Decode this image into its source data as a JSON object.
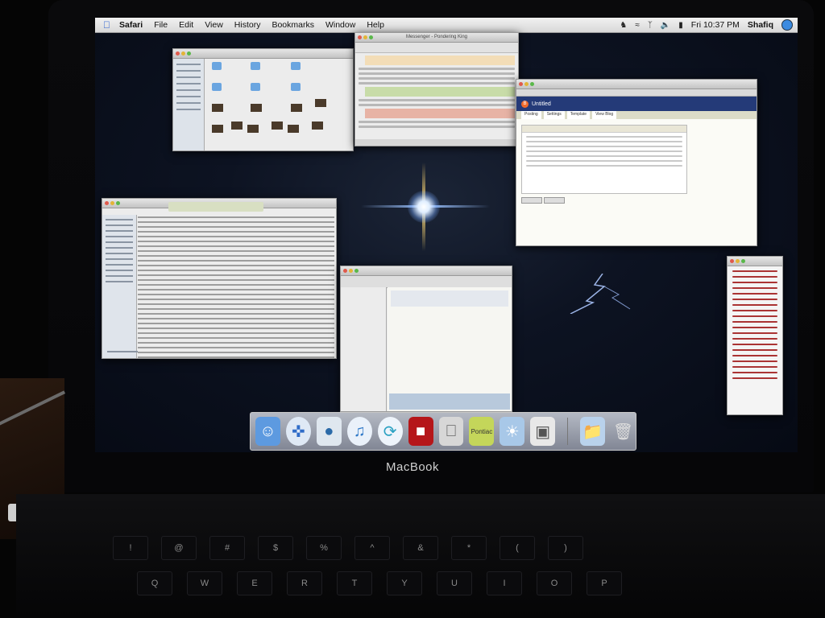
{
  "menubar": {
    "app": "Safari",
    "items": [
      "File",
      "Edit",
      "View",
      "History",
      "Bookmarks",
      "Window",
      "Help"
    ],
    "clock": "Fri 10:37 PM",
    "user": "Shafiq"
  },
  "windows": {
    "messenger_title": "Messenger - Pondering King",
    "blogger_title": "Untitled",
    "blogger_tabs": [
      "Posting",
      "Settings",
      "Template",
      "View Blog"
    ]
  },
  "dock": {
    "items": [
      "finder",
      "safari",
      "iphoto",
      "itunes",
      "messenger",
      "photo-booth",
      "system-prefs",
      "pontiac",
      "downloads",
      "preview",
      "documents",
      "trash"
    ],
    "badge_text": "Pontiac"
  },
  "laptop": {
    "brand": "MacBook"
  },
  "keyboard": {
    "row_top": [
      "!",
      "@",
      "#",
      "$",
      "%",
      "^",
      "&",
      "*",
      "(",
      ")"
    ],
    "row_qwerty": [
      "Q",
      "W",
      "E",
      "R",
      "T",
      "Y",
      "U",
      "I",
      "O",
      "P"
    ]
  }
}
